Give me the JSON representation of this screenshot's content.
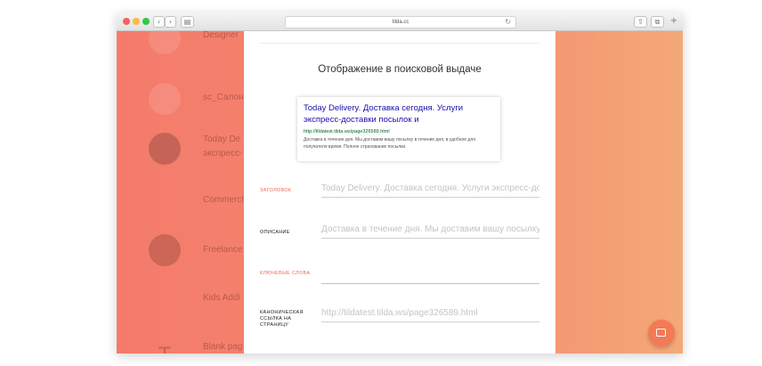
{
  "browser": {
    "address": "tilda.cc",
    "nav_back": "‹",
    "nav_forward": "›",
    "sidebar_glyph": "▤",
    "share_glyph": "⇪",
    "tabs_glyph": "⧉",
    "newtab_glyph": "+",
    "reload_glyph": "↻"
  },
  "background_items": [
    {
      "label": "Designer",
      "icon": "osi-logo-icon"
    },
    {
      "label": "sc_Салон",
      "icon": "osi-logo-icon"
    },
    {
      "label": "Today De",
      "label2": "экспресс-",
      "icon": "photo-avatar-icon"
    },
    {
      "label": "Commercl",
      "icon": ""
    },
    {
      "label": "Freelance",
      "icon": "portrait-avatar-icon"
    },
    {
      "label": "Kids Addi",
      "icon": ""
    },
    {
      "label": "Blank pag",
      "icon": "t-logo-icon"
    }
  ],
  "panel": {
    "section_title": "Отображение в поисковой выдаче",
    "preview": {
      "title": "Today Delivery. Доставка сегодня. Услуги экспресс-доставки посылок и",
      "url": "http://tildatest.tilda.ws/page326589.html",
      "description": "Доставка в течение дня. Мы доставим вашу посылку в течение дня, в удобное для получателя время. Полное страхование посылки."
    },
    "fields": {
      "title_label": "ЗАГОЛОВОК",
      "title_value": "Today Delivery. Доставка сегодня. Услуги экспресс-до",
      "description_label": "ОПИСАНИЕ",
      "description_value": "Доставка в течение дня. Мы доставим вашу посылку",
      "keywords_label": "КЛЮЧЕВЫЕ СЛОВА",
      "keywords_value": "",
      "canonical_label": "КАНОНИЧЕСКАЯ ССЫЛКА НА СТРАНИЦУ",
      "canonical_placeholder": "http://tildatest.tilda.ws/page326589.html"
    }
  },
  "colors": {
    "accent": "#f06a55",
    "link_blue": "#1a0dab",
    "url_green": "#006621",
    "chat_button": "#f47a55"
  }
}
